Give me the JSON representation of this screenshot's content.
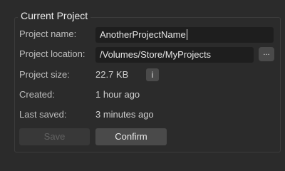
{
  "group": {
    "title": "Current Project"
  },
  "fields": {
    "name": {
      "label": "Project name:",
      "value": "AnotherProjectName"
    },
    "location": {
      "label": "Project location:",
      "value": "/Volumes/Store/MyProjects",
      "browse_label": "..."
    },
    "size": {
      "label": "Project size:",
      "value": "22.7 KB",
      "info_label": "i"
    },
    "created": {
      "label": "Created:",
      "value": "1 hour ago"
    },
    "last_saved": {
      "label": "Last saved:",
      "value": "3 minutes ago"
    }
  },
  "buttons": {
    "save_label": "Save",
    "confirm_label": "Confirm"
  },
  "colors": {
    "background": "#2b2b2b",
    "field_background": "#1e1e1e",
    "button_background": "#4a4a4a",
    "disabled_text": "#626262"
  }
}
